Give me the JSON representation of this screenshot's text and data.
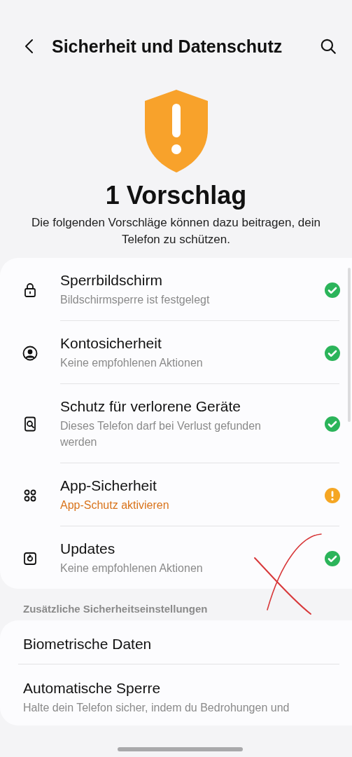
{
  "header": {
    "title": "Sicherheit und Datenschutz"
  },
  "summary": {
    "title": "1 Vorschlag",
    "description": "Die folgenden Vorschläge können dazu beitragen, dein Telefon zu schützen."
  },
  "checks": [
    {
      "kind": "lock",
      "title": "Sperrbildschirm",
      "subtitle": "Bildschirmsperre ist festgelegt",
      "warning": false
    },
    {
      "kind": "account",
      "title": "Kontosicherheit",
      "subtitle": "Keine empfohlenen Aktionen",
      "warning": false
    },
    {
      "kind": "device",
      "title": "Schutz für verlorene Geräte",
      "subtitle": "Dieses Telefon darf bei Verlust gefunden werden",
      "warning": false
    },
    {
      "kind": "apps",
      "title": "App-Sicherheit",
      "subtitle": "App-Schutz aktivieren",
      "warning": true
    },
    {
      "kind": "updates",
      "title": "Updates",
      "subtitle": "Keine empfohlenen Aktionen",
      "warning": false
    }
  ],
  "additional": {
    "heading": "Zusätzliche Sicherheitseinstellungen",
    "items": [
      {
        "title": "Biometrische Daten"
      },
      {
        "title": "Automatische Sperre",
        "subtitle": "Halte dein Telefon sicher, indem du Bedrohungen und"
      }
    ]
  }
}
